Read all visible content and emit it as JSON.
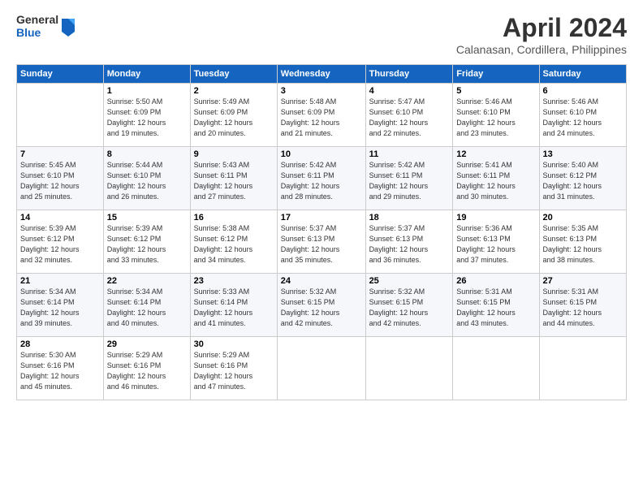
{
  "logo": {
    "general": "General",
    "blue": "Blue"
  },
  "title": "April 2024",
  "location": "Calanasan, Cordillera, Philippines",
  "weekdays": [
    "Sunday",
    "Monday",
    "Tuesday",
    "Wednesday",
    "Thursday",
    "Friday",
    "Saturday"
  ],
  "weeks": [
    [
      {
        "day": "",
        "text": ""
      },
      {
        "day": "1",
        "text": "Sunrise: 5:50 AM\nSunset: 6:09 PM\nDaylight: 12 hours\nand 19 minutes."
      },
      {
        "day": "2",
        "text": "Sunrise: 5:49 AM\nSunset: 6:09 PM\nDaylight: 12 hours\nand 20 minutes."
      },
      {
        "day": "3",
        "text": "Sunrise: 5:48 AM\nSunset: 6:09 PM\nDaylight: 12 hours\nand 21 minutes."
      },
      {
        "day": "4",
        "text": "Sunrise: 5:47 AM\nSunset: 6:10 PM\nDaylight: 12 hours\nand 22 minutes."
      },
      {
        "day": "5",
        "text": "Sunrise: 5:46 AM\nSunset: 6:10 PM\nDaylight: 12 hours\nand 23 minutes."
      },
      {
        "day": "6",
        "text": "Sunrise: 5:46 AM\nSunset: 6:10 PM\nDaylight: 12 hours\nand 24 minutes."
      }
    ],
    [
      {
        "day": "7",
        "text": "Sunrise: 5:45 AM\nSunset: 6:10 PM\nDaylight: 12 hours\nand 25 minutes."
      },
      {
        "day": "8",
        "text": "Sunrise: 5:44 AM\nSunset: 6:10 PM\nDaylight: 12 hours\nand 26 minutes."
      },
      {
        "day": "9",
        "text": "Sunrise: 5:43 AM\nSunset: 6:11 PM\nDaylight: 12 hours\nand 27 minutes."
      },
      {
        "day": "10",
        "text": "Sunrise: 5:42 AM\nSunset: 6:11 PM\nDaylight: 12 hours\nand 28 minutes."
      },
      {
        "day": "11",
        "text": "Sunrise: 5:42 AM\nSunset: 6:11 PM\nDaylight: 12 hours\nand 29 minutes."
      },
      {
        "day": "12",
        "text": "Sunrise: 5:41 AM\nSunset: 6:11 PM\nDaylight: 12 hours\nand 30 minutes."
      },
      {
        "day": "13",
        "text": "Sunrise: 5:40 AM\nSunset: 6:12 PM\nDaylight: 12 hours\nand 31 minutes."
      }
    ],
    [
      {
        "day": "14",
        "text": "Sunrise: 5:39 AM\nSunset: 6:12 PM\nDaylight: 12 hours\nand 32 minutes."
      },
      {
        "day": "15",
        "text": "Sunrise: 5:39 AM\nSunset: 6:12 PM\nDaylight: 12 hours\nand 33 minutes."
      },
      {
        "day": "16",
        "text": "Sunrise: 5:38 AM\nSunset: 6:12 PM\nDaylight: 12 hours\nand 34 minutes."
      },
      {
        "day": "17",
        "text": "Sunrise: 5:37 AM\nSunset: 6:13 PM\nDaylight: 12 hours\nand 35 minutes."
      },
      {
        "day": "18",
        "text": "Sunrise: 5:37 AM\nSunset: 6:13 PM\nDaylight: 12 hours\nand 36 minutes."
      },
      {
        "day": "19",
        "text": "Sunrise: 5:36 AM\nSunset: 6:13 PM\nDaylight: 12 hours\nand 37 minutes."
      },
      {
        "day": "20",
        "text": "Sunrise: 5:35 AM\nSunset: 6:13 PM\nDaylight: 12 hours\nand 38 minutes."
      }
    ],
    [
      {
        "day": "21",
        "text": "Sunrise: 5:34 AM\nSunset: 6:14 PM\nDaylight: 12 hours\nand 39 minutes."
      },
      {
        "day": "22",
        "text": "Sunrise: 5:34 AM\nSunset: 6:14 PM\nDaylight: 12 hours\nand 40 minutes."
      },
      {
        "day": "23",
        "text": "Sunrise: 5:33 AM\nSunset: 6:14 PM\nDaylight: 12 hours\nand 41 minutes."
      },
      {
        "day": "24",
        "text": "Sunrise: 5:32 AM\nSunset: 6:15 PM\nDaylight: 12 hours\nand 42 minutes."
      },
      {
        "day": "25",
        "text": "Sunrise: 5:32 AM\nSunset: 6:15 PM\nDaylight: 12 hours\nand 42 minutes."
      },
      {
        "day": "26",
        "text": "Sunrise: 5:31 AM\nSunset: 6:15 PM\nDaylight: 12 hours\nand 43 minutes."
      },
      {
        "day": "27",
        "text": "Sunrise: 5:31 AM\nSunset: 6:15 PM\nDaylight: 12 hours\nand 44 minutes."
      }
    ],
    [
      {
        "day": "28",
        "text": "Sunrise: 5:30 AM\nSunset: 6:16 PM\nDaylight: 12 hours\nand 45 minutes."
      },
      {
        "day": "29",
        "text": "Sunrise: 5:29 AM\nSunset: 6:16 PM\nDaylight: 12 hours\nand 46 minutes."
      },
      {
        "day": "30",
        "text": "Sunrise: 5:29 AM\nSunset: 6:16 PM\nDaylight: 12 hours\nand 47 minutes."
      },
      {
        "day": "",
        "text": ""
      },
      {
        "day": "",
        "text": ""
      },
      {
        "day": "",
        "text": ""
      },
      {
        "day": "",
        "text": ""
      }
    ]
  ]
}
